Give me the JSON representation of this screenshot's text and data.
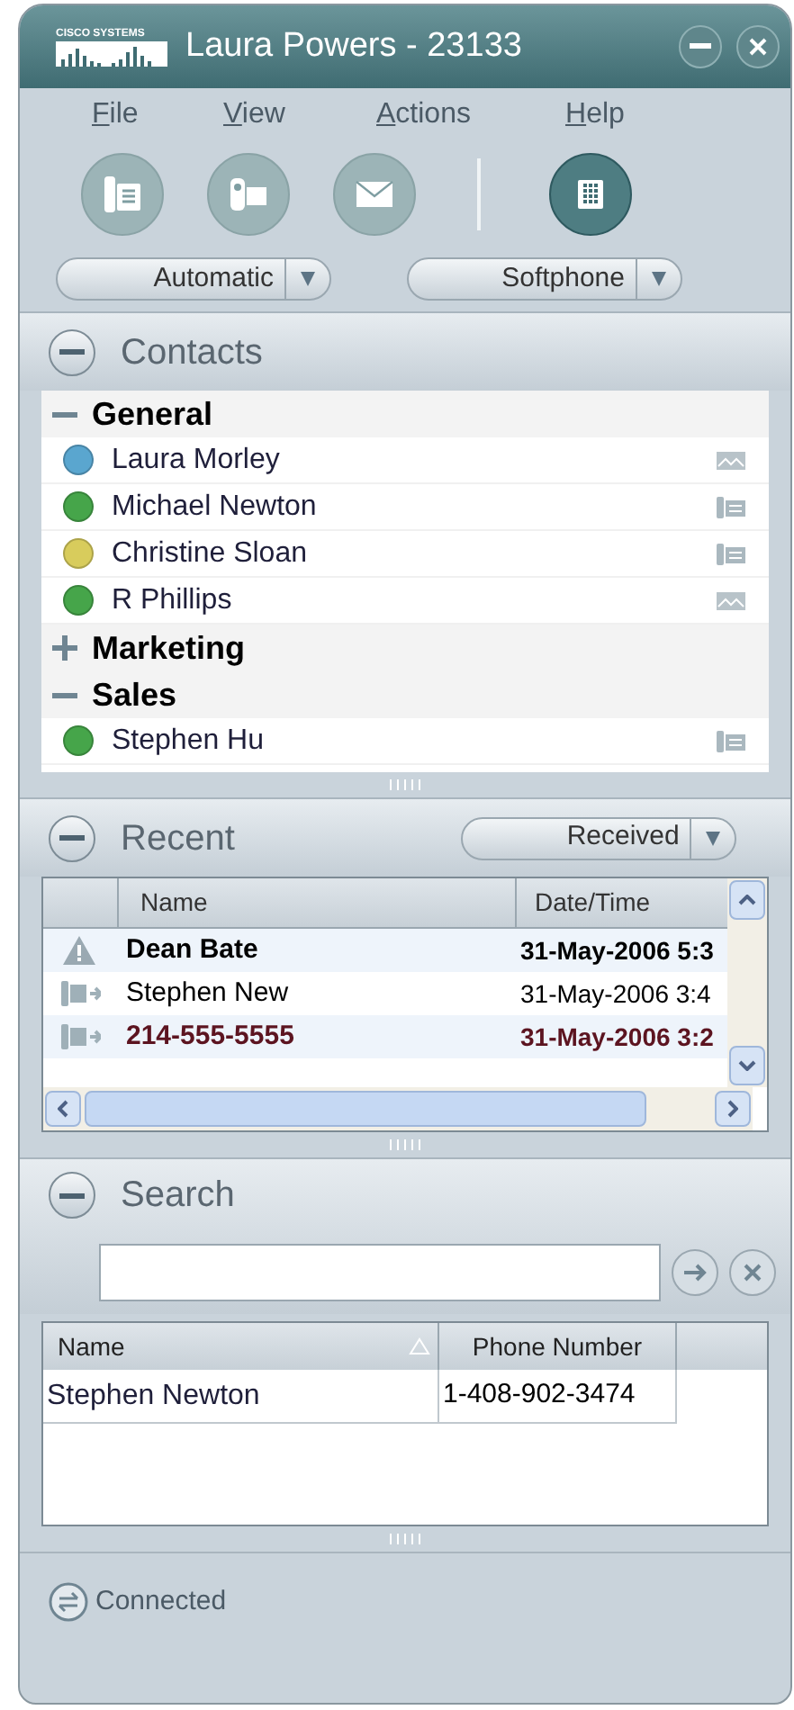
{
  "window": {
    "logo": "CISCO SYSTEMS",
    "title": "Laura Powers - 23133"
  },
  "menu": [
    "File",
    "View",
    "Actions",
    "Help"
  ],
  "toolbar": [
    {
      "kind": "phone",
      "selected": false
    },
    {
      "kind": "video",
      "selected": false
    },
    {
      "kind": "mail",
      "selected": false
    },
    {
      "kind": "dialpad",
      "selected": true
    }
  ],
  "selectors": [
    {
      "value": "Automatic"
    },
    {
      "value": "Softphone"
    }
  ],
  "contacts": {
    "title": "Contacts",
    "expanded": true,
    "groups": [
      {
        "name": "General",
        "expanded": true,
        "children": [
          {
            "name": "Laura Morley",
            "color": "#5aa6cf",
            "kind": "mail"
          },
          {
            "name": "Michael Newton",
            "color": "#46a54a",
            "kind": "phone"
          },
          {
            "name": "Christine Sloan",
            "color": "#d8cc5c",
            "kind": "phone"
          },
          {
            "name": "R Phillips",
            "color": "#46a54a",
            "kind": "mail"
          }
        ]
      },
      {
        "name": "Marketing",
        "expanded": false
      },
      {
        "name": "Sales",
        "expanded": true,
        "children": [
          {
            "name": "Stephen Hu",
            "color": "#46a54a",
            "kind": "phone"
          }
        ]
      }
    ]
  },
  "recent": {
    "title": "Recent",
    "expanded": true,
    "filter": "Received",
    "columns": [
      "Name",
      "Date/Time"
    ],
    "rows": [
      {
        "kind": "missed",
        "unread": true,
        "color": "#000000",
        "name": "Dean Bate",
        "time": "31-May-2006 5:3"
      },
      {
        "kind": "received",
        "unread": false,
        "color": "#000000",
        "name": "Stephen New",
        "time": "31-May-2006 3:4"
      },
      {
        "kind": "received",
        "unread": true,
        "color": "#5c1420",
        "name": "214-555-5555",
        "time": "31-May-2006 3:2"
      }
    ]
  },
  "search": {
    "title": "Search",
    "expanded": true,
    "columns": [
      "Name",
      "Phone Number"
    ],
    "rows": [
      {
        "name": "Stephen Newton",
        "phone": "1-408-902-3474"
      }
    ]
  },
  "status_bar": {
    "text": "Connected"
  }
}
